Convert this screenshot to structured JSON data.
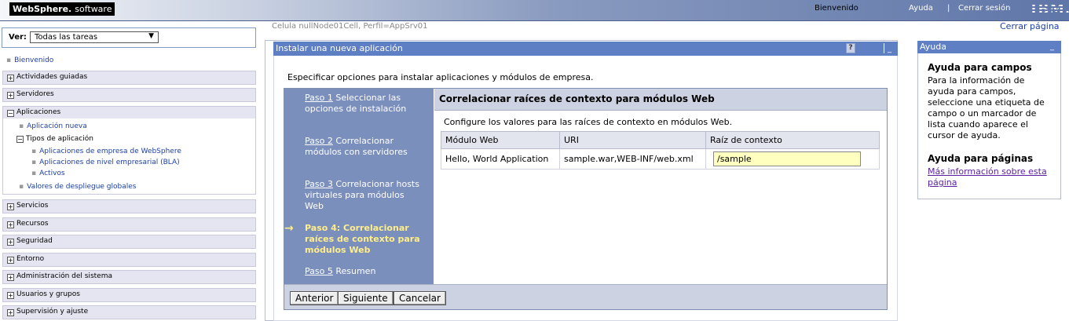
{
  "header": {
    "brand": "WebSphere.",
    "brand_suffix": "software",
    "welcome": "Bienvenido",
    "help": "Ayuda",
    "separator": "|",
    "logout": "Cerrar sesión",
    "logo": "IBM."
  },
  "nav": {
    "view_label": "Ver:",
    "view_value": "Todas las tareas",
    "welcome_link": "Bienvenido",
    "categories": [
      {
        "label": "Actividades guiadas",
        "state": "+"
      },
      {
        "label": "Servidores",
        "state": "+"
      },
      {
        "label": "Aplicaciones",
        "state": "−"
      },
      {
        "label": "Servicios",
        "state": "+"
      },
      {
        "label": "Recursos",
        "state": "+"
      },
      {
        "label": "Seguridad",
        "state": "+"
      },
      {
        "label": "Entorno",
        "state": "+"
      },
      {
        "label": "Administración del sistema",
        "state": "+"
      },
      {
        "label": "Usuarios y grupos",
        "state": "+"
      },
      {
        "label": "Supervisión y ajuste",
        "state": "+"
      }
    ],
    "apps": {
      "new_app": "Aplicación nueva",
      "types_label": "Tipos de aplicación",
      "types_state": "−",
      "types": [
        "Aplicaciones de empresa de WebSphere",
        "Aplicaciones de nivel empresarial (BLA)",
        "Activos"
      ],
      "deploy_values": "Valores de despliegue globales"
    }
  },
  "main": {
    "cell_info": "Celula nullNode01Cell, Perfil=AppSrv01",
    "close_page": "Cerrar página",
    "panel_title": "Instalar una nueva aplicación",
    "help_q": "?",
    "minimize": "_",
    "intro": "Especificar opciones para instalar aplicaciones y módulos de empresa.",
    "steps": [
      {
        "link": "Paso 1",
        "text": "Seleccionar las opciones de instalación"
      },
      {
        "link": "Paso 2",
        "text": "Correlacionar módulos con servidores"
      },
      {
        "link": "Paso 3",
        "text": "Correlacionar hosts virtuales para módulos Web"
      },
      {
        "link": "",
        "text": "Paso 4: Correlacionar raíces de contexto para módulos Web"
      },
      {
        "link": "Paso 5",
        "text": "Resumen"
      }
    ],
    "current_arrow": "→",
    "step_header": "Correlacionar raíces de contexto para módulos Web",
    "step_desc": "Configure los valores para las raíces de contexto en módulos Web.",
    "table": {
      "headers": [
        "Módulo Web",
        "URI",
        "Raíz de contexto"
      ],
      "row": {
        "module": "Hello, World Application",
        "uri": "sample.war,WEB-INF/web.xml",
        "context_root": "/sample"
      }
    },
    "buttons": {
      "prev": "Anterior",
      "next": "Siguiente",
      "cancel": "Cancelar"
    }
  },
  "help": {
    "title": "Ayuda",
    "minimize": "_",
    "fields_title": "Ayuda para campos",
    "fields_text": "Para la información de ayuda para campos, seleccione una etiqueta de campo o un marcador de lista cuando aparece el cursor de ayuda.",
    "pages_title": "Ayuda para páginas",
    "pages_link": "Más información sobre esta página"
  }
}
